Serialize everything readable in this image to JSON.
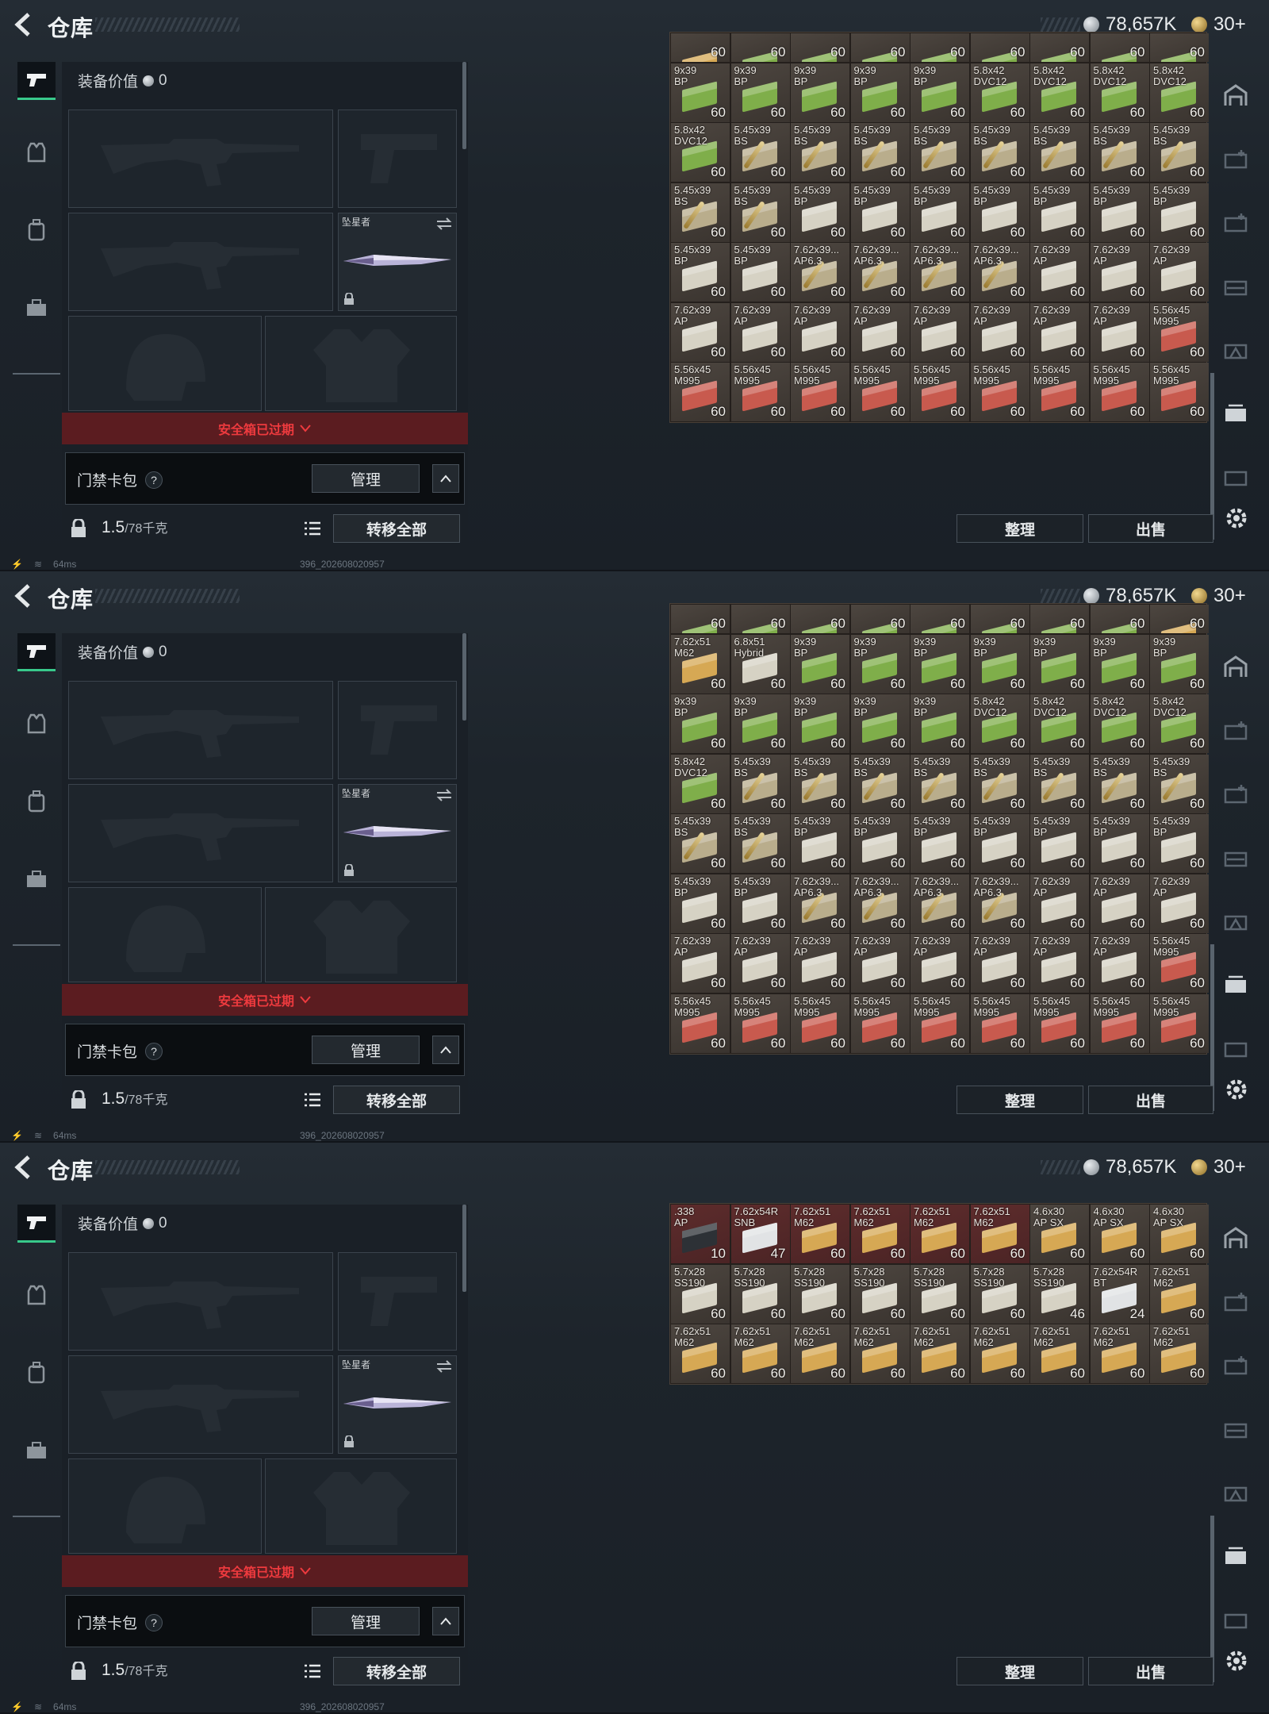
{
  "header": {
    "title": "仓库",
    "currency_a": "78,657K",
    "currency_b": "30+"
  },
  "loadout": {
    "equip_value_label": "装备价值",
    "equip_value": "0",
    "melee_name": "坠星者"
  },
  "safebox": {
    "expired_label": "安全箱已过期"
  },
  "cardpack": {
    "label": "门禁卡包",
    "help": "?",
    "manage_label": "管理"
  },
  "capacity": {
    "current": "1.5",
    "max": "/78千克",
    "transfer_label": "转移全部"
  },
  "actions": {
    "sort_label": "整理",
    "sell_label": "出售"
  },
  "status": {
    "ping": "64ms",
    "build": "396_202608020957"
  },
  "colors": {
    "accent": "#38c98b",
    "alert": "#ee3a3e",
    "alert_bg": "#5b1c20",
    "grid_bg": "#241f1c"
  },
  "icons": [
    "back-arrow-icon",
    "silver-coin-icon",
    "gold-coin-icon",
    "pistol-icon",
    "vest-icon",
    "backpack-icon",
    "case-icon",
    "lock-icon",
    "list-icon",
    "chevron-up-icon",
    "chevron-down-icon",
    "swap-icon",
    "helmet-icon",
    "gear-icon",
    "wifi-icon",
    "battery-icon"
  ],
  "panels": [
    {
      "rows": [
        {
          "partial": true,
          "cells": [
            [
              "",
              "60",
              "y"
            ],
            [
              "",
              "60",
              "g"
            ],
            [
              "",
              "60",
              "g"
            ],
            [
              "",
              "60",
              "g"
            ],
            [
              "",
              "60",
              "g"
            ],
            [
              "",
              "60",
              "g"
            ],
            [
              "",
              "60",
              "g"
            ],
            [
              "",
              "60",
              "g"
            ],
            [
              "",
              "60",
              "g"
            ]
          ]
        },
        {
          "cells": [
            [
              "9x39\nBP",
              "60",
              "g"
            ],
            [
              "9x39\nBP",
              "60",
              "g"
            ],
            [
              "9x39\nBP",
              "60",
              "g"
            ],
            [
              "9x39\nBP",
              "60",
              "g"
            ],
            [
              "9x39\nBP",
              "60",
              "g"
            ],
            [
              "5.8x42\nDVC12",
              "60",
              "g"
            ],
            [
              "5.8x42\nDVC12",
              "60",
              "g"
            ],
            [
              "5.8x42\nDVC12",
              "60",
              "g"
            ],
            [
              "5.8x42\nDVC12",
              "60",
              "g"
            ]
          ]
        },
        {
          "cells": [
            [
              "5.8x42\nDVC12",
              "60",
              "g"
            ],
            [
              "5.45x39\nBS",
              "60",
              "b"
            ],
            [
              "5.45x39\nBS",
              "60",
              "b"
            ],
            [
              "5.45x39\nBS",
              "60",
              "b"
            ],
            [
              "5.45x39\nBS",
              "60",
              "b"
            ],
            [
              "5.45x39\nBS",
              "60",
              "b"
            ],
            [
              "5.45x39\nBS",
              "60",
              "b"
            ],
            [
              "5.45x39\nBS",
              "60",
              "b"
            ],
            [
              "5.45x39\nBS",
              "60",
              "b"
            ]
          ]
        },
        {
          "cells": [
            [
              "5.45x39\nBS",
              "60",
              "b"
            ],
            [
              "5.45x39\nBS",
              "60",
              "b"
            ],
            [
              "5.45x39\nBP",
              "60",
              "w"
            ],
            [
              "5.45x39\nBP",
              "60",
              "w"
            ],
            [
              "5.45x39\nBP",
              "60",
              "w"
            ],
            [
              "5.45x39\nBP",
              "60",
              "w"
            ],
            [
              "5.45x39\nBP",
              "60",
              "w"
            ],
            [
              "5.45x39\nBP",
              "60",
              "w"
            ],
            [
              "5.45x39\nBP",
              "60",
              "w"
            ]
          ]
        },
        {
          "cells": [
            [
              "5.45x39\nBP",
              "60",
              "w"
            ],
            [
              "5.45x39\nBP",
              "60",
              "w"
            ],
            [
              "7.62x39...\nAP6.3",
              "60",
              "b"
            ],
            [
              "7.62x39...\nAP6.3",
              "60",
              "b"
            ],
            [
              "7.62x39...\nAP6.3",
              "60",
              "b"
            ],
            [
              "7.62x39...\nAP6.3",
              "60",
              "b"
            ],
            [
              "7.62x39\nAP",
              "60",
              "w"
            ],
            [
              "7.62x39\nAP",
              "60",
              "w"
            ],
            [
              "7.62x39\nAP",
              "60",
              "w"
            ]
          ]
        },
        {
          "cells": [
            [
              "7.62x39\nAP",
              "60",
              "w"
            ],
            [
              "7.62x39\nAP",
              "60",
              "w"
            ],
            [
              "7.62x39\nAP",
              "60",
              "w"
            ],
            [
              "7.62x39\nAP",
              "60",
              "w"
            ],
            [
              "7.62x39\nAP",
              "60",
              "w"
            ],
            [
              "7.62x39\nAP",
              "60",
              "w"
            ],
            [
              "7.62x39\nAP",
              "60",
              "w"
            ],
            [
              "7.62x39\nAP",
              "60",
              "w"
            ],
            [
              "5.56x45\nM995",
              "60",
              "r"
            ]
          ]
        },
        {
          "cells": [
            [
              "5.56x45\nM995",
              "60",
              "r"
            ],
            [
              "5.56x45\nM995",
              "60",
              "r"
            ],
            [
              "5.56x45\nM995",
              "60",
              "r"
            ],
            [
              "5.56x45\nM995",
              "60",
              "r"
            ],
            [
              "5.56x45\nM995",
              "60",
              "r"
            ],
            [
              "5.56x45\nM995",
              "60",
              "r"
            ],
            [
              "5.56x45\nM995",
              "60",
              "r"
            ],
            [
              "5.56x45\nM995",
              "60",
              "r"
            ],
            [
              "5.56x45\nM995",
              "60",
              "r"
            ]
          ]
        }
      ]
    },
    {
      "rows": [
        {
          "partial": true,
          "cells": [
            [
              "",
              "60",
              "g"
            ],
            [
              "",
              "60",
              "g"
            ],
            [
              "",
              "60",
              "g"
            ],
            [
              "",
              "60",
              "g"
            ],
            [
              "",
              "60",
              "g"
            ],
            [
              "",
              "60",
              "g"
            ],
            [
              "",
              "60",
              "g"
            ],
            [
              "",
              "60",
              "g"
            ],
            [
              "",
              "60",
              "y"
            ]
          ]
        },
        {
          "cells": [
            [
              "7.62x51\nM62",
              "60",
              "y"
            ],
            [
              "6.8x51\nHybrid",
              "60",
              "w"
            ],
            [
              "9x39\nBP",
              "60",
              "g"
            ],
            [
              "9x39\nBP",
              "60",
              "g"
            ],
            [
              "9x39\nBP",
              "60",
              "g"
            ],
            [
              "9x39\nBP",
              "60",
              "g"
            ],
            [
              "9x39\nBP",
              "60",
              "g"
            ],
            [
              "9x39\nBP",
              "60",
              "g"
            ],
            [
              "9x39\nBP",
              "60",
              "g"
            ]
          ]
        },
        {
          "cells": [
            [
              "9x39\nBP",
              "60",
              "g"
            ],
            [
              "9x39\nBP",
              "60",
              "g"
            ],
            [
              "9x39\nBP",
              "60",
              "g"
            ],
            [
              "9x39\nBP",
              "60",
              "g"
            ],
            [
              "9x39\nBP",
              "60",
              "g"
            ],
            [
              "5.8x42\nDVC12",
              "60",
              "g"
            ],
            [
              "5.8x42\nDVC12",
              "60",
              "g"
            ],
            [
              "5.8x42\nDVC12",
              "60",
              "g"
            ],
            [
              "5.8x42\nDVC12",
              "60",
              "g"
            ]
          ]
        },
        {
          "cells": [
            [
              "5.8x42\nDVC12",
              "60",
              "g"
            ],
            [
              "5.45x39\nBS",
              "60",
              "b"
            ],
            [
              "5.45x39\nBS",
              "60",
              "b"
            ],
            [
              "5.45x39\nBS",
              "60",
              "b"
            ],
            [
              "5.45x39\nBS",
              "60",
              "b"
            ],
            [
              "5.45x39\nBS",
              "60",
              "b"
            ],
            [
              "5.45x39\nBS",
              "60",
              "b"
            ],
            [
              "5.45x39\nBS",
              "60",
              "b"
            ],
            [
              "5.45x39\nBS",
              "60",
              "b"
            ]
          ]
        },
        {
          "cells": [
            [
              "5.45x39\nBS",
              "60",
              "b"
            ],
            [
              "5.45x39\nBS",
              "60",
              "b"
            ],
            [
              "5.45x39\nBP",
              "60",
              "w"
            ],
            [
              "5.45x39\nBP",
              "60",
              "w"
            ],
            [
              "5.45x39\nBP",
              "60",
              "w"
            ],
            [
              "5.45x39\nBP",
              "60",
              "w"
            ],
            [
              "5.45x39\nBP",
              "60",
              "w"
            ],
            [
              "5.45x39\nBP",
              "60",
              "w"
            ],
            [
              "5.45x39\nBP",
              "60",
              "w"
            ]
          ]
        },
        {
          "cells": [
            [
              "5.45x39\nBP",
              "60",
              "w"
            ],
            [
              "5.45x39\nBP",
              "60",
              "w"
            ],
            [
              "7.62x39...\nAP6.3",
              "60",
              "b"
            ],
            [
              "7.62x39...\nAP6.3",
              "60",
              "b"
            ],
            [
              "7.62x39...\nAP6.3",
              "60",
              "b"
            ],
            [
              "7.62x39...\nAP6.3",
              "60",
              "b"
            ],
            [
              "7.62x39\nAP",
              "60",
              "w"
            ],
            [
              "7.62x39\nAP",
              "60",
              "w"
            ],
            [
              "7.62x39\nAP",
              "60",
              "w"
            ]
          ]
        },
        {
          "cells": [
            [
              "7.62x39\nAP",
              "60",
              "w"
            ],
            [
              "7.62x39\nAP",
              "60",
              "w"
            ],
            [
              "7.62x39\nAP",
              "60",
              "w"
            ],
            [
              "7.62x39\nAP",
              "60",
              "w"
            ],
            [
              "7.62x39\nAP",
              "60",
              "w"
            ],
            [
              "7.62x39\nAP",
              "60",
              "w"
            ],
            [
              "7.62x39\nAP",
              "60",
              "w"
            ],
            [
              "7.62x39\nAP",
              "60",
              "w"
            ],
            [
              "5.56x45\nM995",
              "60",
              "r"
            ]
          ]
        },
        {
          "cells": [
            [
              "5.56x45\nM995",
              "60",
              "r"
            ],
            [
              "5.56x45\nM995",
              "60",
              "r"
            ],
            [
              "5.56x45\nM995",
              "60",
              "r"
            ],
            [
              "5.56x45\nM995",
              "60",
              "r"
            ],
            [
              "5.56x45\nM995",
              "60",
              "r"
            ],
            [
              "5.56x45\nM995",
              "60",
              "r"
            ],
            [
              "5.56x45\nM995",
              "60",
              "r"
            ],
            [
              "5.56x45\nM995",
              "60",
              "r"
            ],
            [
              "5.56x45\nM995",
              "60",
              "r"
            ]
          ]
        }
      ]
    },
    {
      "rows": [
        {
          "cells": [
            [
              ".338\nAP",
              "10",
              "k",
              true
            ],
            [
              "7.62x54R\nSNB",
              "47",
              "s",
              true
            ],
            [
              "7.62x51\nM62",
              "60",
              "y",
              true
            ],
            [
              "7.62x51\nM62",
              "60",
              "y",
              true
            ],
            [
              "7.62x51\nM62",
              "60",
              "y",
              true
            ],
            [
              "7.62x51\nM62",
              "60",
              "y",
              true
            ],
            [
              "4.6x30\nAP SX",
              "60",
              "y"
            ],
            [
              "4.6x30\nAP SX",
              "60",
              "y"
            ],
            [
              "4.6x30\nAP SX",
              "60",
              "y"
            ]
          ]
        },
        {
          "cells": [
            [
              "5.7x28\nSS190",
              "60",
              "w"
            ],
            [
              "5.7x28\nSS190",
              "60",
              "w"
            ],
            [
              "5.7x28\nSS190",
              "60",
              "w"
            ],
            [
              "5.7x28\nSS190",
              "60",
              "w"
            ],
            [
              "5.7x28\nSS190",
              "60",
              "w"
            ],
            [
              "5.7x28\nSS190",
              "60",
              "w"
            ],
            [
              "5.7x28\nSS190",
              "46",
              "w"
            ],
            [
              "7.62x54R\nBT",
              "24",
              "s"
            ],
            [
              "7.62x51\nM62",
              "60",
              "y"
            ]
          ]
        },
        {
          "cells": [
            [
              "7.62x51\nM62",
              "60",
              "y"
            ],
            [
              "7.62x51\nM62",
              "60",
              "y"
            ],
            [
              "7.62x51\nM62",
              "60",
              "y"
            ],
            [
              "7.62x51\nM62",
              "60",
              "y"
            ],
            [
              "7.62x51\nM62",
              "60",
              "y"
            ],
            [
              "7.62x51\nM62",
              "60",
              "y"
            ],
            [
              "7.62x51\nM62",
              "60",
              "y"
            ],
            [
              "7.62x51\nM62",
              "60",
              "y"
            ],
            [
              "7.62x51\nM62",
              "60",
              "y"
            ]
          ]
        }
      ]
    }
  ]
}
